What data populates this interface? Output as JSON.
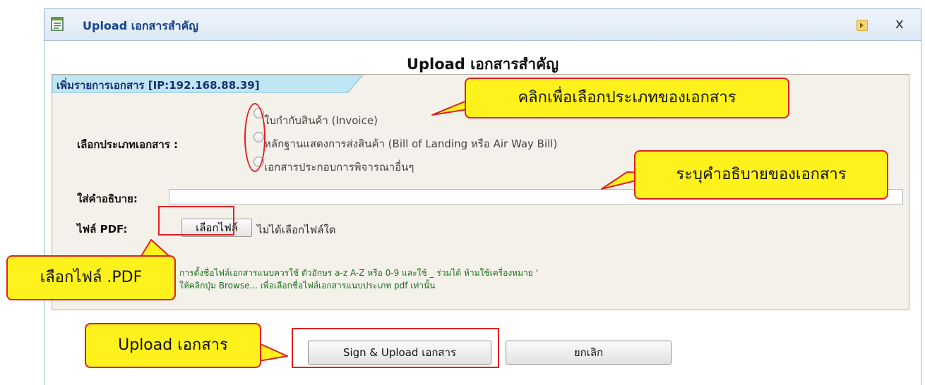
{
  "window": {
    "title": "Upload เอกสารสำคัญ",
    "minimize_icon": "dock-icon",
    "close_label": "x"
  },
  "heading": "Upload เอกสารสำคัญ",
  "panel": {
    "tab_label": "เพิ่มรายการเอกสาร [IP:192.168.88.39]",
    "doc_type_label": "เลือกประเภทเอกสาร :",
    "doc_types": [
      "ใบกำกับสินค้า (Invoice)",
      "หลักฐานแสดงการส่งสินค้า (Bill of Landing หรือ Air Way Bill)",
      "เอกสารประกอบการพิจารณาอื่นๆ"
    ],
    "description_label": "ใส่คำอธิบาย:",
    "description_value": "",
    "file_label": "ไฟล์ PDF:",
    "file_button": "เลือกไฟล์",
    "no_file_text": "ไม่ได้เลือกไฟล์ใด",
    "note_line1": "การตั้งชื่อไฟล์เอกสารแนบควรใช้ ตัวอักษร a-z A-Z หรือ 0-9 และใช้ _ ร่วมได้ ห้ามใช้เครื่องหมาย '",
    "note_line2": "ให้คลิกปุ่ม Browse... เพื่อเลือกชื่อไฟล์เอกสารแนบประเภท pdf เท่านั้น"
  },
  "buttons": {
    "upload": "Sign & Upload เอกสาร",
    "cancel": "ยกเลิก"
  },
  "callouts": {
    "doc_type": "คลิกเพื่อเลือกประเภทของเอกสาร",
    "description": "ระบุคำอธิบายของเอกสาร",
    "file": "เลือกไฟล์ .PDF",
    "upload": "Upload เอกสาร"
  },
  "colors": {
    "callout_fill": "#fff21c",
    "highlight_red": "#e02020",
    "title_text": "#15428b",
    "panel_bg": "#f4f1ea",
    "tab_fill": "#bfe6f5"
  }
}
